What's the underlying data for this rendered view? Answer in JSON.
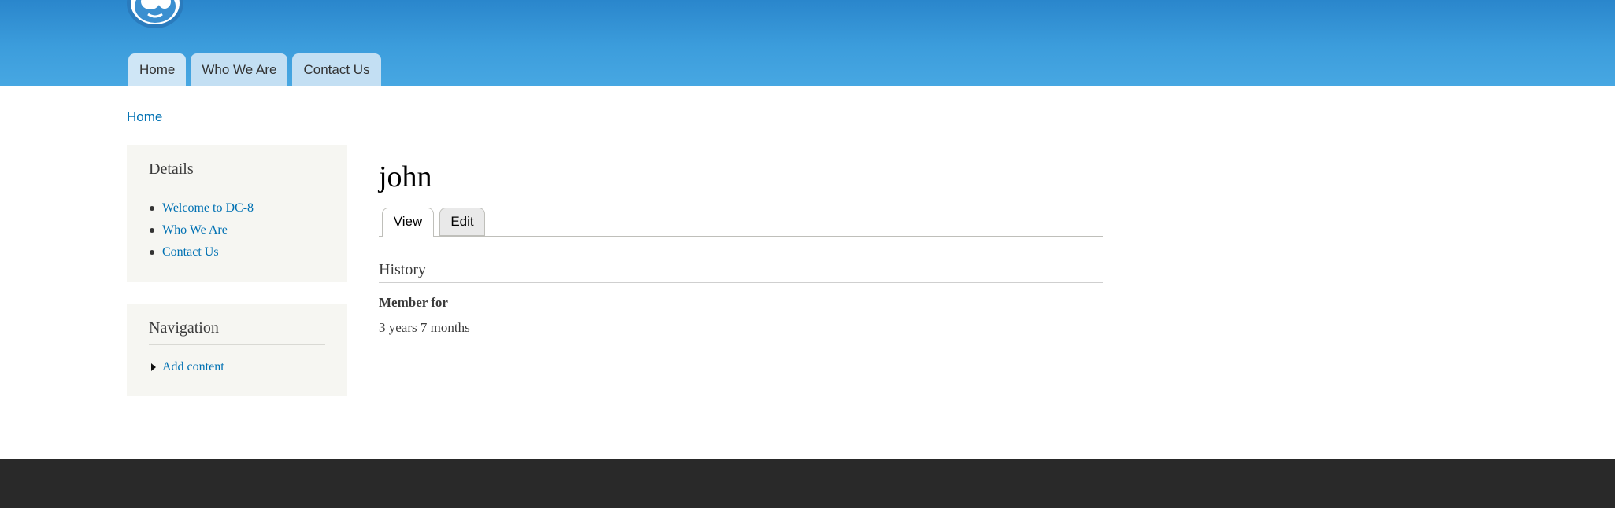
{
  "header": {
    "logo_icon": "drupal-drop-icon",
    "nav": [
      {
        "label": "Home"
      },
      {
        "label": "Who We Are"
      },
      {
        "label": "Contact Us"
      }
    ]
  },
  "breadcrumb": {
    "home": "Home"
  },
  "sidebar": {
    "details": {
      "title": "Details",
      "items": [
        {
          "label": "Welcome to DC-8"
        },
        {
          "label": "Who We Are"
        },
        {
          "label": "Contact Us"
        }
      ]
    },
    "navigation": {
      "title": "Navigation",
      "items": [
        {
          "label": "Add content"
        }
      ]
    }
  },
  "main": {
    "title": "john",
    "tabs": [
      {
        "label": "View"
      },
      {
        "label": "Edit"
      }
    ],
    "section_title": "History",
    "field_label": "Member for",
    "field_value": "3 years 7 months"
  },
  "colors": {
    "header_top": "#2a86cc",
    "header_bottom": "#47a7e2",
    "link": "#0071b3",
    "footer": "#292929",
    "sidebar_bg": "#f6f6f2"
  }
}
